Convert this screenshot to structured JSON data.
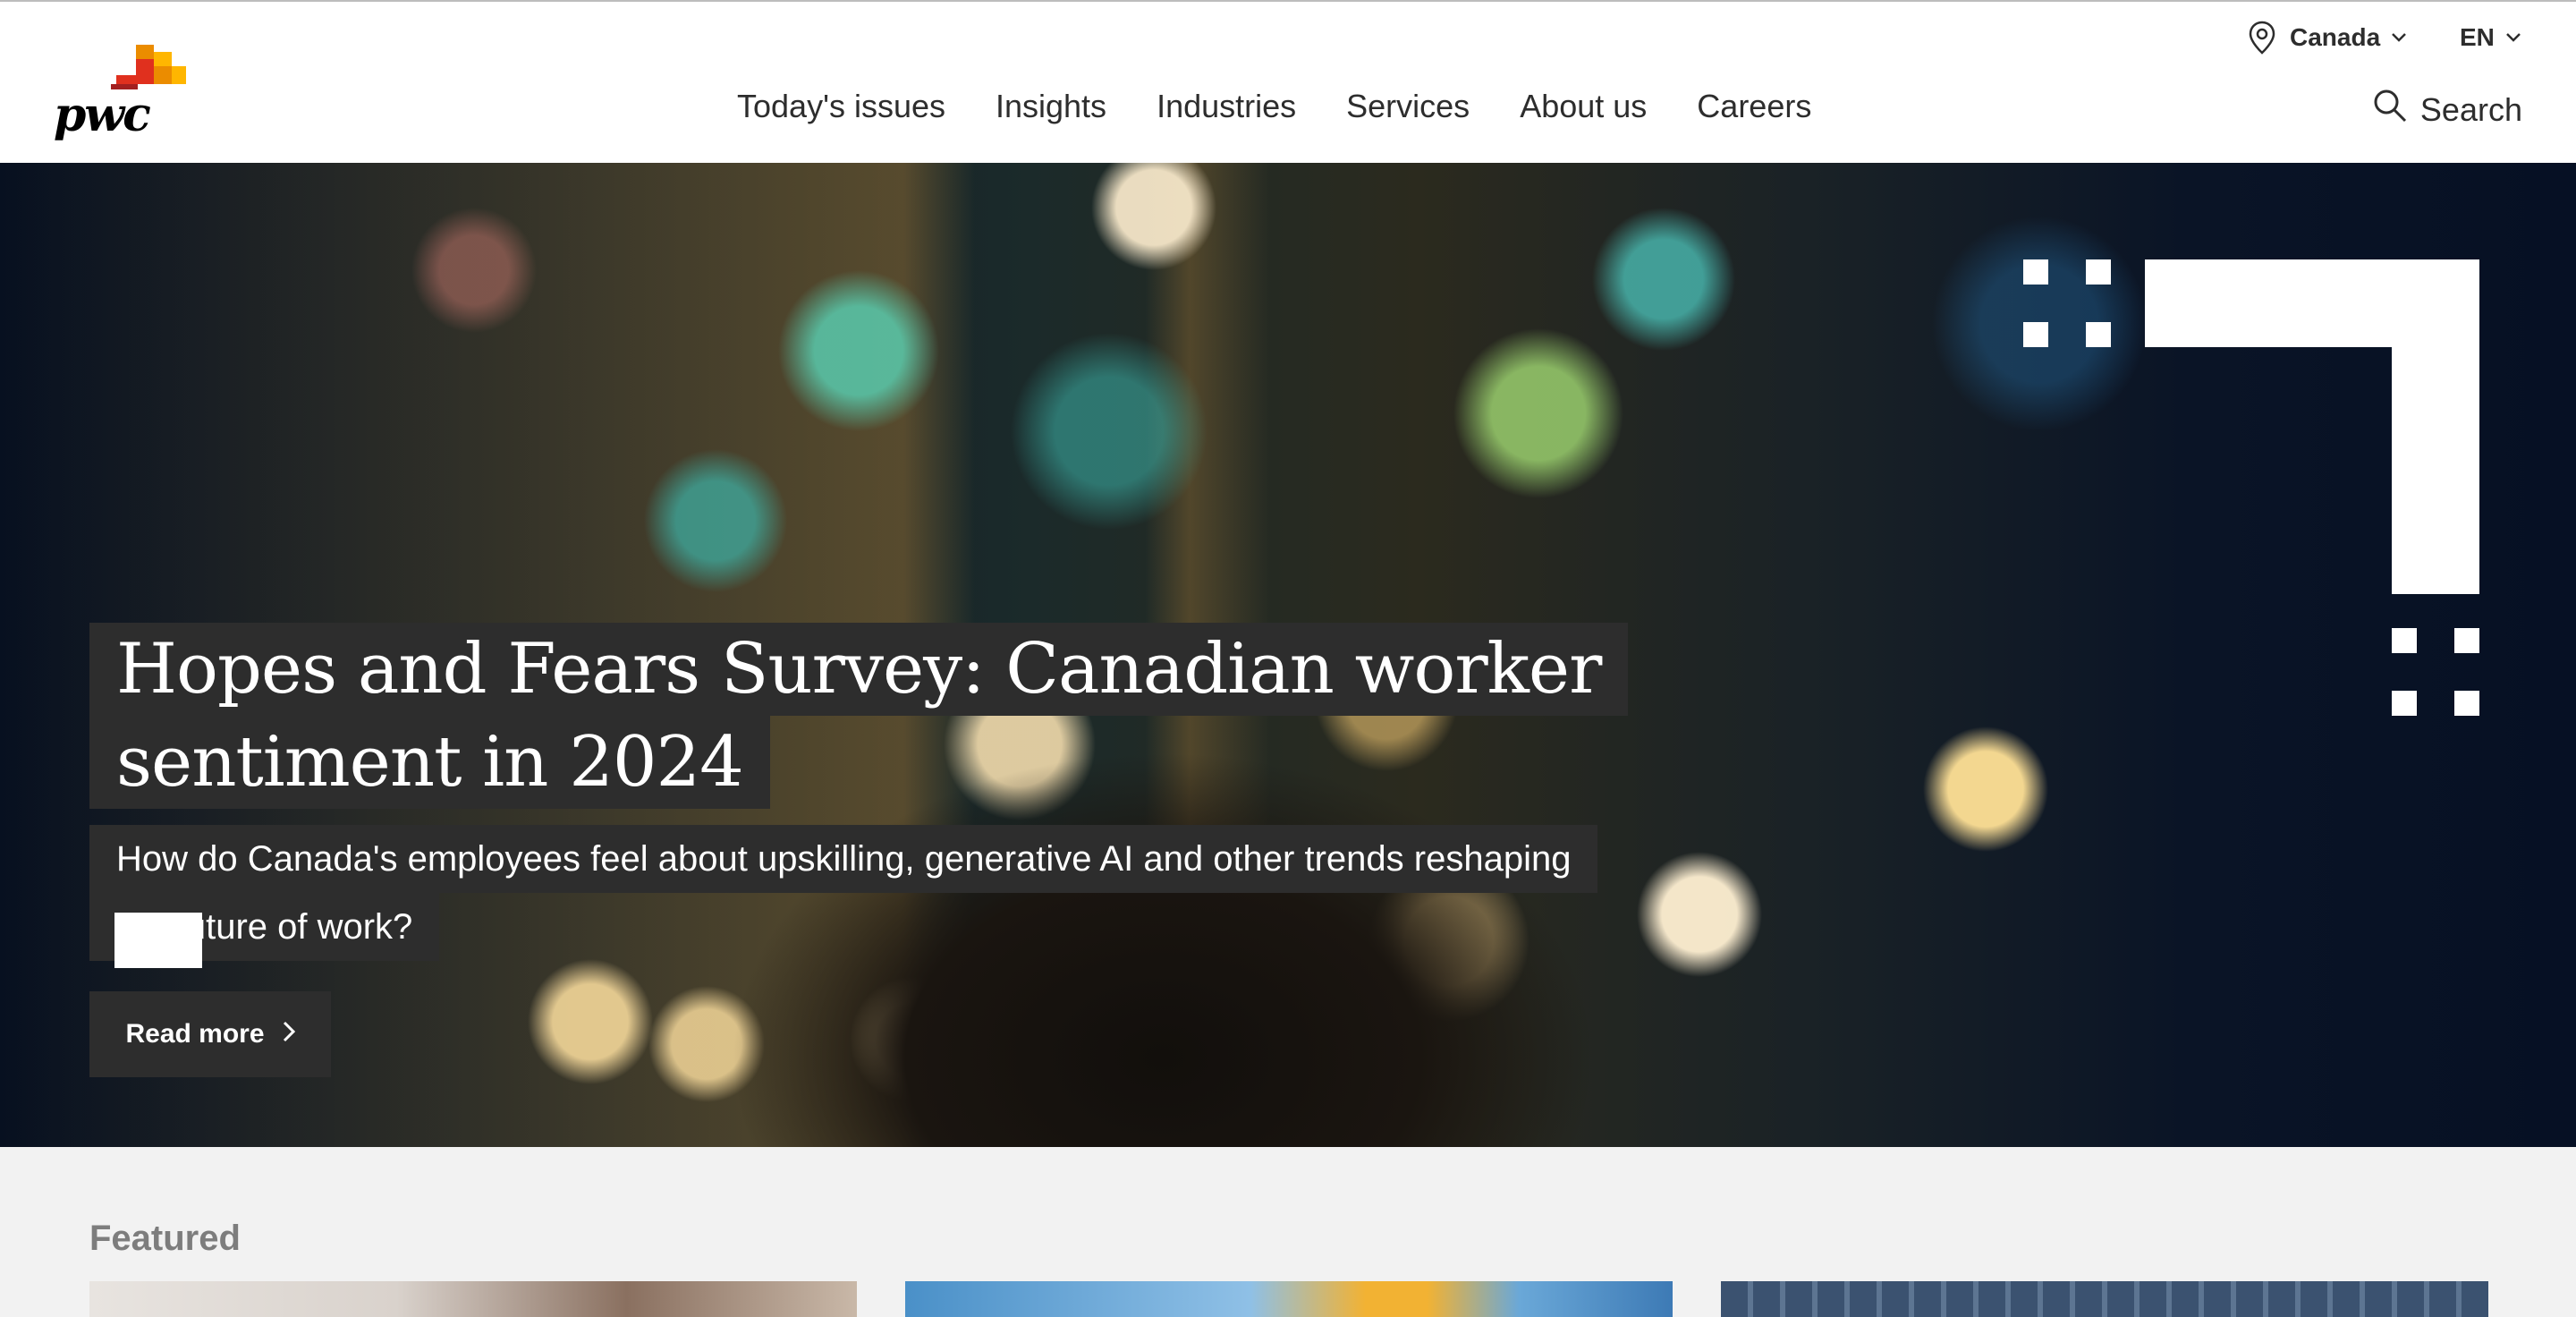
{
  "header": {
    "logo_text": "pwc",
    "location": "Canada",
    "language": "EN",
    "nav": [
      "Today's issues",
      "Insights",
      "Industries",
      "Services",
      "About us",
      "Careers"
    ],
    "search_label": "Search"
  },
  "hero": {
    "title_line1": "Hopes and Fears Survey: Canadian worker",
    "title_line2": "sentiment in 2024",
    "subtitle_line1": "How do Canada's employees feel about upskilling, generative AI and other trends reshaping",
    "subtitle_line2": "the future of work?",
    "cta_label": "Read more"
  },
  "featured": {
    "heading": "Featured"
  },
  "colors": {
    "text_dark": "#2d2d2d",
    "overlay": "#2d2d2d",
    "logo_orange": "#e0301e",
    "logo_yellow": "#ffb600",
    "logo_red": "#a32020",
    "featured_bg": "#f2f2f2"
  }
}
